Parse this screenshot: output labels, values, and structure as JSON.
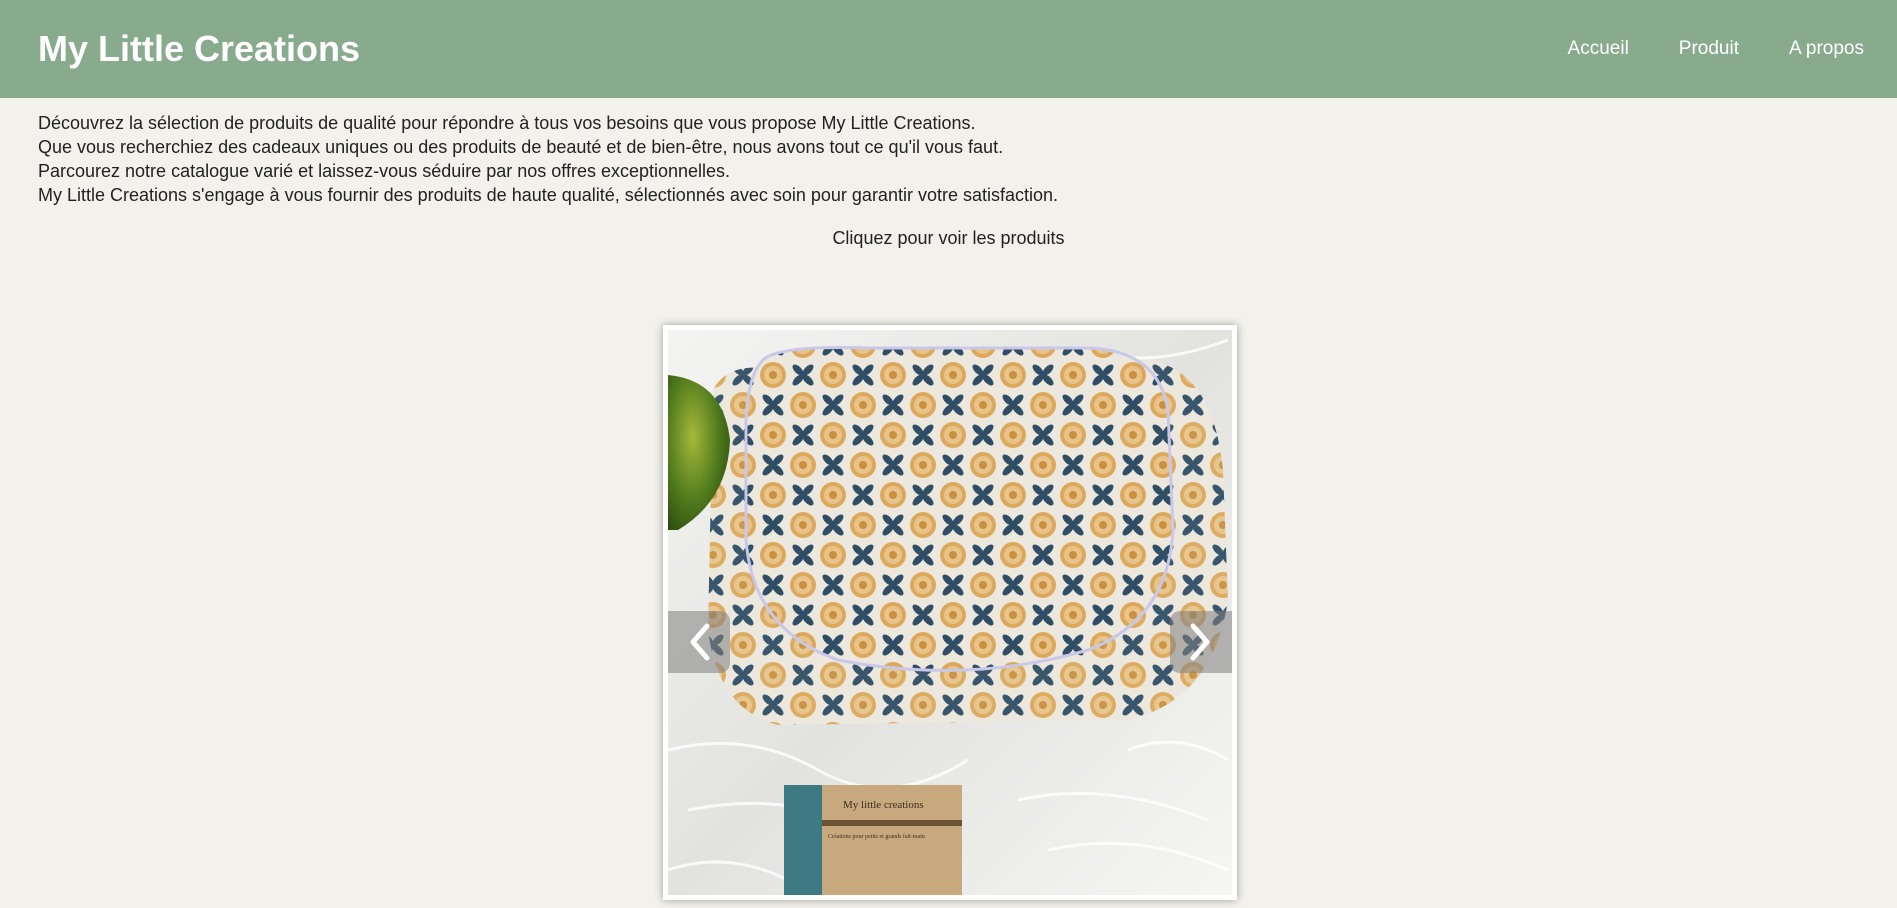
{
  "header": {
    "brand": "My Little Creations",
    "nav": [
      {
        "label": "Accueil"
      },
      {
        "label": "Produit"
      },
      {
        "label": "A propos"
      }
    ]
  },
  "intro": {
    "lines": [
      "Découvrez la sélection de produits de qualité pour répondre à tous vos besoins que vous propose My Little Creations.",
      "Que vous recherchiez des cadeaux uniques ou des produits de beauté et de bien-être, nous avons tout ce qu'il vous faut.",
      "Parcourez notre catalogue varié et laissez-vous séduire par nos offres exceptionnelles.",
      "My Little Creations s'engage à vous fournir des produits de haute qualité, sélectionnés avec soin pour garantir votre satisfaction."
    ]
  },
  "cta": {
    "label": "Cliquez pour voir les produits"
  },
  "carousel": {
    "card": {
      "title": "My little creations",
      "subtitle": "Créations pour petits et grands fait-main"
    },
    "prev_icon": "chevron-left-icon",
    "next_icon": "chevron-right-icon"
  },
  "colors": {
    "header_bg": "#87ab8c",
    "page_bg": "#f2f1ec",
    "navy_petal": "#2f4e66",
    "mustard_flower": "#d9a85a"
  }
}
